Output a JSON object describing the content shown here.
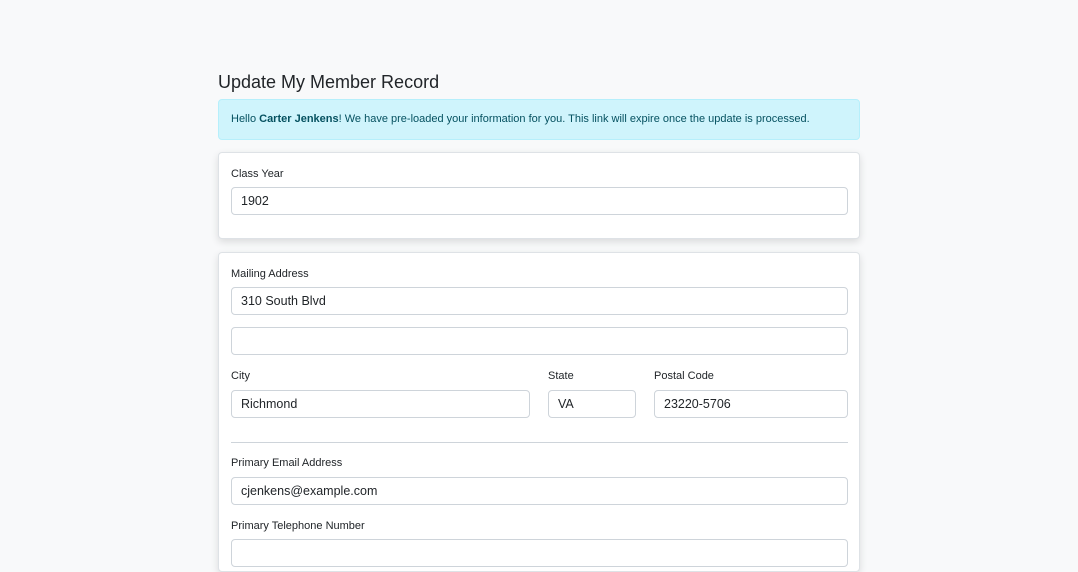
{
  "page": {
    "title": "Update My Member Record"
  },
  "alert": {
    "prefix": "Hello ",
    "name": "Carter Jenkens",
    "suffix": "! We have pre-loaded your information for you. This link will expire once the update is processed."
  },
  "class_year": {
    "label": "Class Year",
    "value": "1902"
  },
  "address": {
    "label": "Mailing Address",
    "line1": "310 South Blvd",
    "line2": "",
    "city_label": "City",
    "city": "Richmond",
    "state_label": "State",
    "state": "VA",
    "postal_label": "Postal Code",
    "postal": "23220-5706"
  },
  "contact": {
    "email_label": "Primary Email Address",
    "email": "cjenkens@example.com",
    "phone_label": "Primary Telephone Number",
    "phone": ""
  },
  "colors": {
    "alert_bg": "#cff4fc",
    "alert_text": "#055160",
    "page_bg": "#f8f9fa"
  }
}
